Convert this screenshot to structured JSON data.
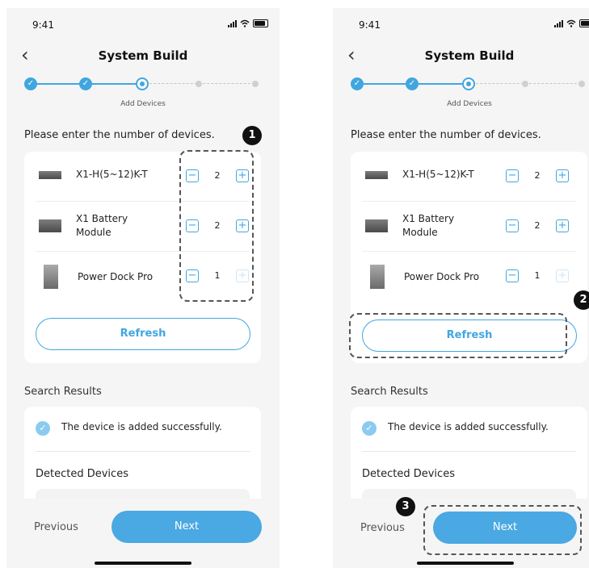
{
  "status": {
    "time": "9:41"
  },
  "header": {
    "title": "System Build"
  },
  "stepper": {
    "current_step_label": "Add Devices"
  },
  "instruction": "Please enter the number of devices.",
  "devices": [
    {
      "name": "X1-H(5~12)K-T",
      "quantity": "2",
      "minus": "−",
      "plus": "+"
    },
    {
      "name": "X1 Battery Module",
      "quantity": "2",
      "minus": "−",
      "plus": "+"
    },
    {
      "name": "Power Dock Pro",
      "quantity": "1",
      "minus": "−",
      "plus": "+",
      "plus_disabled": true
    }
  ],
  "refresh_label": "Refresh",
  "search_results": {
    "title": "Search Results",
    "success_message": "The device is added successfully.",
    "detected_title": "Detected Devices"
  },
  "footer": {
    "previous_label": "Previous",
    "next_label": "Next"
  },
  "annotations": {
    "badge1": "1",
    "badge2": "2",
    "badge3": "3"
  },
  "icons": {
    "back": "chevron-left-icon",
    "check": "check-circle-icon",
    "signal": "signal-icon",
    "wifi": "wifi-icon",
    "battery": "battery-icon"
  },
  "colors": {
    "accent": "#41a6e0",
    "next_button": "#4aa8e3",
    "background": "#f5f5f5"
  }
}
